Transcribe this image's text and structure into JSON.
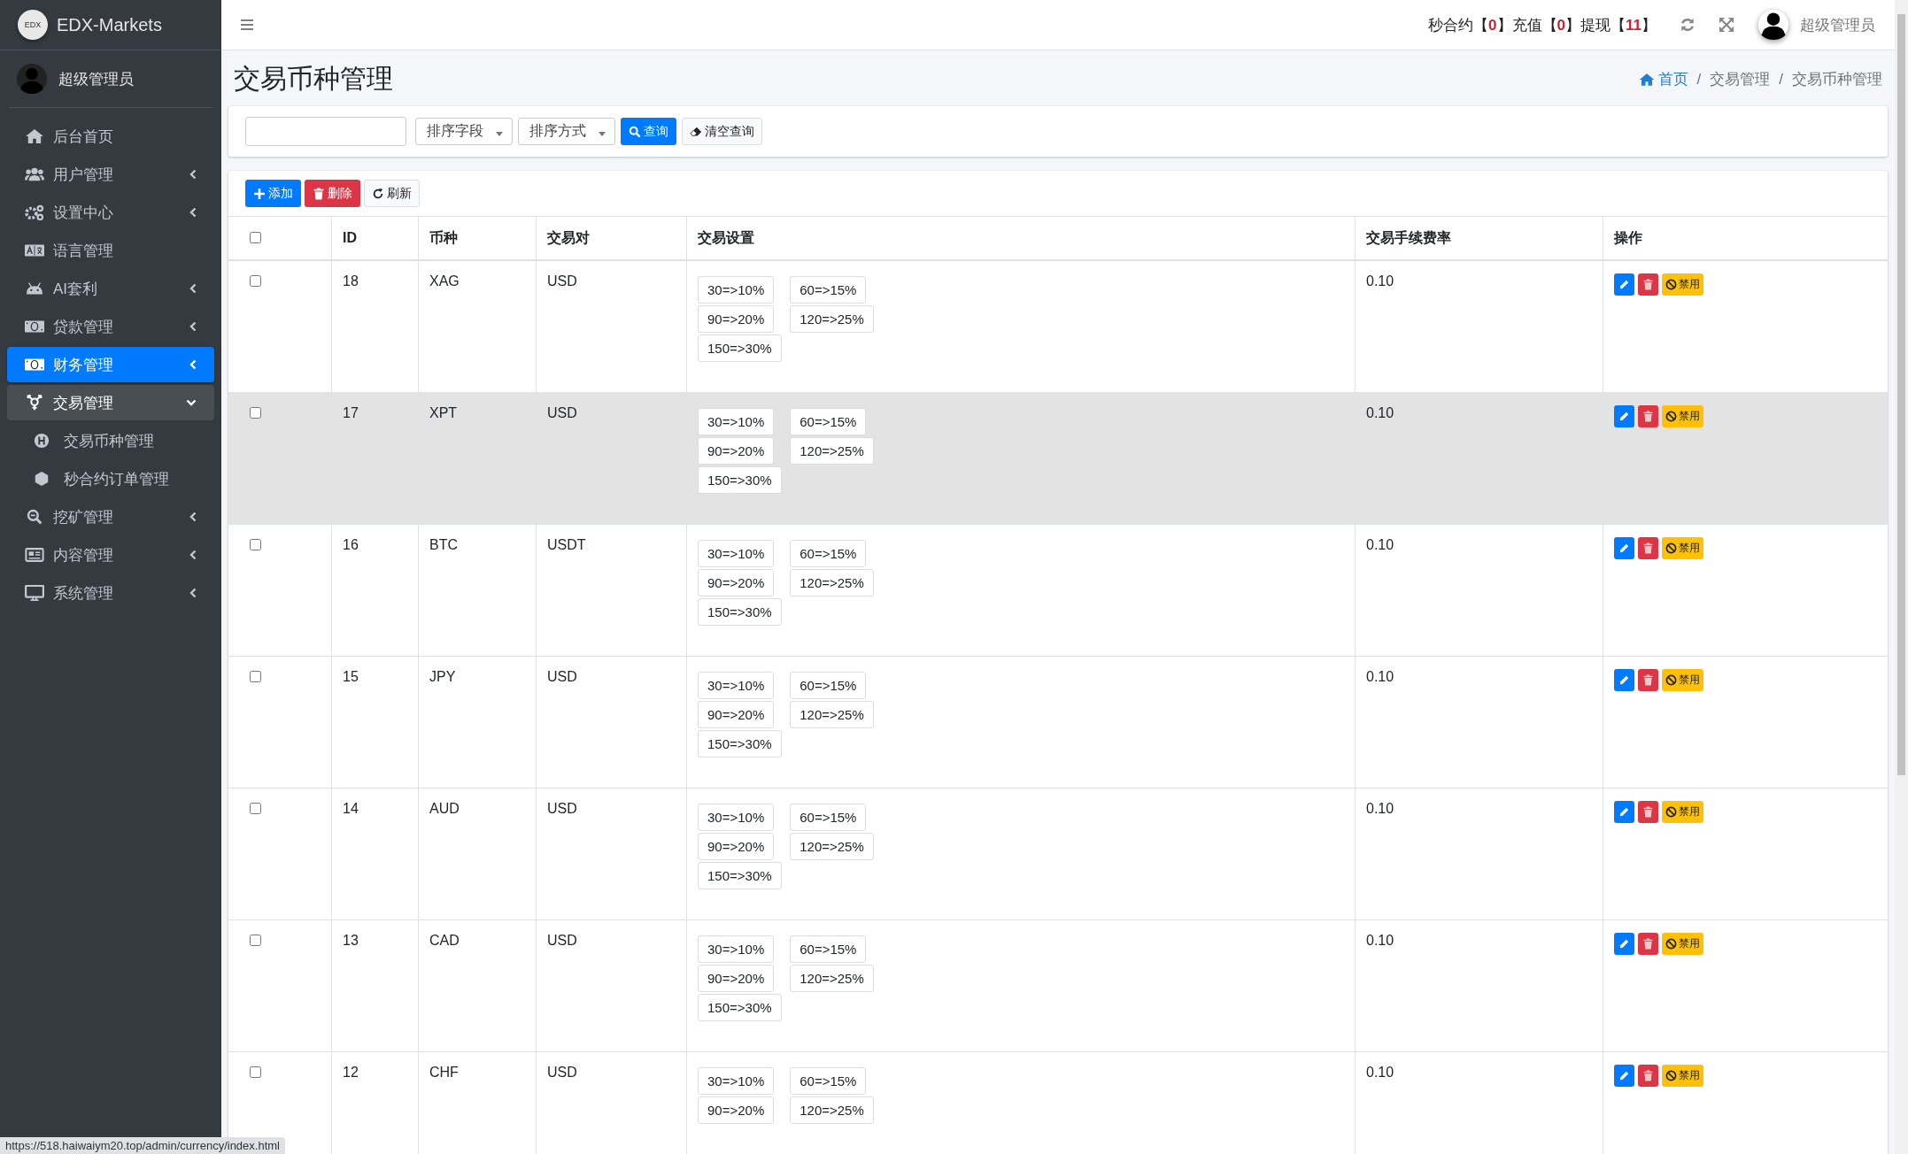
{
  "sidebar": {
    "brand": {
      "logo_text": "EDX",
      "name": "EDX-Markets"
    },
    "user": "超级管理员",
    "items": [
      {
        "label": "后台首页",
        "kind": "home",
        "expandable": false,
        "expanded": false,
        "selected": false
      },
      {
        "label": "用户管理",
        "kind": "users",
        "expandable": true,
        "expanded": false,
        "selected": false
      },
      {
        "label": "设置中心",
        "kind": "gears",
        "expandable": true,
        "expanded": false,
        "selected": false
      },
      {
        "label": "语言管理",
        "kind": "language",
        "expandable": false,
        "expanded": false,
        "selected": false
      },
      {
        "label": "AI套利",
        "kind": "android",
        "expandable": true,
        "expanded": false,
        "selected": false
      },
      {
        "label": "贷款管理",
        "kind": "money",
        "expandable": true,
        "expanded": false,
        "selected": false
      },
      {
        "label": "财务管理",
        "kind": "money",
        "expandable": true,
        "expanded": false,
        "selected": true
      },
      {
        "label": "交易管理",
        "kind": "transfer",
        "expandable": true,
        "expanded": true,
        "selected": false,
        "children": [
          {
            "label": "交易币种管理",
            "kind": "h-circle",
            "selected": false
          },
          {
            "label": "秒合约订单管理",
            "kind": "hexagon",
            "selected": false
          }
        ]
      },
      {
        "label": "挖矿管理",
        "kind": "search-minus",
        "expandable": true,
        "expanded": false,
        "selected": false
      },
      {
        "label": "内容管理",
        "kind": "newspaper",
        "expandable": true,
        "expanded": false,
        "selected": false
      },
      {
        "label": "系统管理",
        "kind": "monitor",
        "expandable": true,
        "expanded": false,
        "selected": false
      }
    ]
  },
  "header": {
    "counters": "秒合约【**0**】充值【**0**】提现【**11**】",
    "user": "超级管理员"
  },
  "page": {
    "title": "交易币种管理",
    "breadcrumb": {
      "separator": "/",
      "items": [
        "首页",
        "交易管理",
        "交易币种管理"
      ]
    }
  },
  "search": {
    "sort_field": "排序字段",
    "sort_order": "排序方式",
    "search_button": "查询",
    "clear_button": "清空查询"
  },
  "toolbar": {
    "add": "添加",
    "delete": "删除",
    "refresh": "刷新"
  },
  "table": {
    "select_all": {
      "checked": false
    },
    "columns": [
      "ID",
      "币种",
      "交易对",
      "交易设置",
      "交易手续费率",
      "操作"
    ],
    "rows": [
      {
        "checked": false,
        "hovered": false,
        "id": "18",
        "symbol": "XAG",
        "pair": "USD",
        "settings": [
          "30=>10%",
          "60=>15%",
          "90=>20%",
          "120=>25%",
          "150=>30%"
        ],
        "fee": "0.10",
        "disable": "禁用"
      },
      {
        "checked": false,
        "hovered": true,
        "id": "17",
        "symbol": "XPT",
        "pair": "USD",
        "settings": [
          "30=>10%",
          "60=>15%",
          "90=>20%",
          "120=>25%",
          "150=>30%"
        ],
        "fee": "0.10",
        "disable": "禁用"
      },
      {
        "checked": false,
        "hovered": false,
        "id": "16",
        "symbol": "BTC",
        "pair": "USDT",
        "settings": [
          "30=>10%",
          "60=>15%",
          "90=>20%",
          "120=>25%",
          "150=>30%"
        ],
        "fee": "0.10",
        "disable": "禁用"
      },
      {
        "checked": false,
        "hovered": false,
        "id": "15",
        "symbol": "JPY",
        "pair": "USD",
        "settings": [
          "30=>10%",
          "60=>15%",
          "90=>20%",
          "120=>25%",
          "150=>30%"
        ],
        "fee": "0.10",
        "disable": "禁用"
      },
      {
        "checked": false,
        "hovered": false,
        "id": "14",
        "symbol": "AUD",
        "pair": "USD",
        "settings": [
          "30=>10%",
          "60=>15%",
          "90=>20%",
          "120=>25%",
          "150=>30%"
        ],
        "fee": "0.10",
        "disable": "禁用"
      },
      {
        "checked": false,
        "hovered": false,
        "id": "13",
        "symbol": "CAD",
        "pair": "USD",
        "settings": [
          "30=>10%",
          "60=>15%",
          "90=>20%",
          "120=>25%",
          "150=>30%"
        ],
        "fee": "0.10",
        "disable": "禁用"
      },
      {
        "checked": false,
        "hovered": false,
        "id": "12",
        "symbol": "CHF",
        "pair": "USD",
        "settings": [
          "30=>10%",
          "60=>15%",
          "90=>20%",
          "120=>25%"
        ],
        "fee": "0.10",
        "disable": "禁用"
      }
    ]
  },
  "status_url": "https://518.haiwaiym20.top/admin/currency/index.html"
}
